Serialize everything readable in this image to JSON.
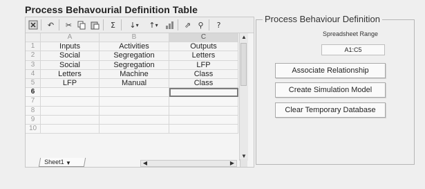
{
  "title": "Process Behavourial Definition Table",
  "spreadsheet": {
    "columns": [
      "A",
      "B",
      "C"
    ],
    "rows": [
      {
        "num": "1",
        "cells": [
          "Inputs",
          "Activities",
          "Outputs"
        ]
      },
      {
        "num": "2",
        "cells": [
          "Social",
          "Segregation",
          "Letters"
        ]
      },
      {
        "num": "3",
        "cells": [
          "Social",
          "Segregation",
          "LFP"
        ]
      },
      {
        "num": "4",
        "cells": [
          "Letters",
          "Machine",
          "Class"
        ]
      },
      {
        "num": "5",
        "cells": [
          "LFP",
          "Manual",
          "Class"
        ]
      },
      {
        "num": "6",
        "cells": [
          "",
          "",
          ""
        ]
      },
      {
        "num": "7",
        "cells": [
          "",
          "",
          ""
        ]
      },
      {
        "num": "8",
        "cells": [
          "",
          "",
          ""
        ]
      },
      {
        "num": "9",
        "cells": [
          "",
          "",
          ""
        ]
      },
      {
        "num": "10",
        "cells": [
          "",
          "",
          ""
        ]
      }
    ],
    "sheet_tab": "Sheet1",
    "toolbar_icons": [
      "excel-icon",
      "undo-icon",
      "cut-icon",
      "copy-icon",
      "paste-icon",
      "autosum-icon",
      "sort-ascending-icon",
      "sort-descending-icon",
      "chart-wizard-icon",
      "export-icon",
      "filter-icon",
      "help-icon"
    ]
  },
  "panel": {
    "legend": "Process Behaviour Definition",
    "range_label": "Spreadsheet Range",
    "range_value": "A1:C5",
    "buttons": {
      "associate": "Associate Relationship",
      "simulate": "Create Simulation Model",
      "clear": "Clear Temporary Database"
    }
  }
}
